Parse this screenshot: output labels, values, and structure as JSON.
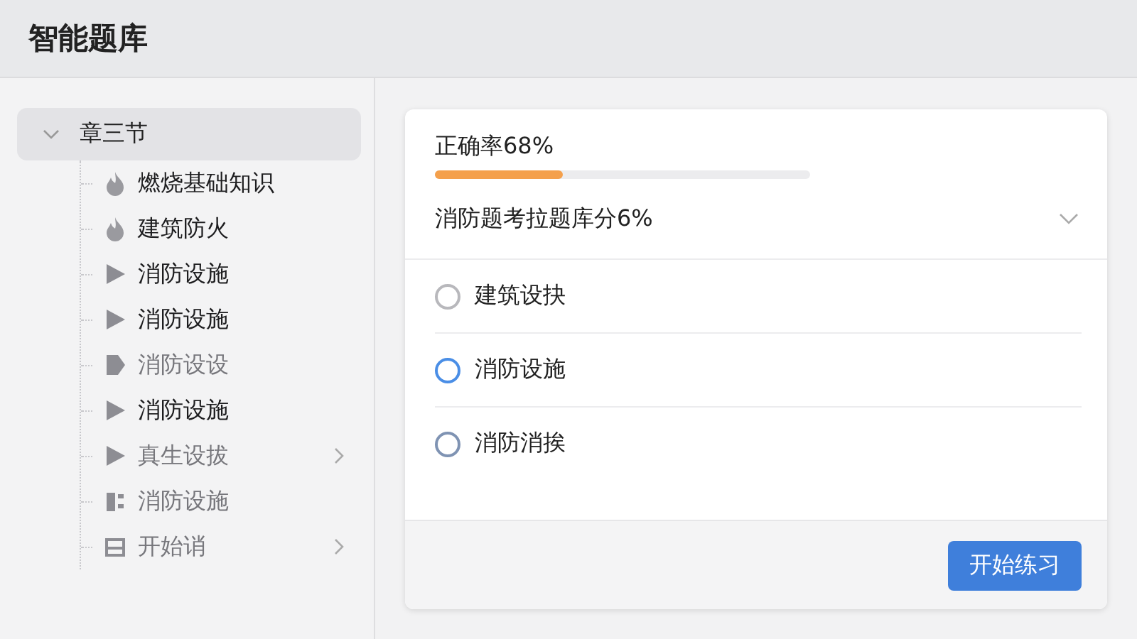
{
  "window": {
    "title": "智能题库"
  },
  "sidebar": {
    "root": {
      "label": "章三节",
      "expanded": true,
      "selected": true,
      "children": [
        {
          "label": "燃烧基础知识",
          "kind": "flame",
          "disabled": false,
          "expandable": false
        },
        {
          "label": "建筑防火",
          "kind": "flame",
          "disabled": false,
          "expandable": false
        },
        {
          "label": "消防设施",
          "kind": "play",
          "disabled": false,
          "expandable": false
        },
        {
          "label": "消防设施",
          "kind": "play",
          "disabled": false,
          "expandable": false
        },
        {
          "label": "消防设设",
          "kind": "tag",
          "disabled": true,
          "expandable": false
        },
        {
          "label": "消防设施",
          "kind": "play",
          "disabled": false,
          "expandable": false
        },
        {
          "label": "真生设拔",
          "kind": "play",
          "disabled": true,
          "expandable": true
        },
        {
          "label": "消防设施",
          "kind": "film",
          "disabled": true,
          "expandable": false
        },
        {
          "label": "开始诮",
          "kind": "tray",
          "disabled": true,
          "expandable": true
        }
      ]
    }
  },
  "card": {
    "accuracy": {
      "label": "正确率68%",
      "level": 0.34
    },
    "dropdown": {
      "value": "消防题考拉题库分6%",
      "expanded": false
    },
    "options": [
      {
        "label": "建筑设抉",
        "selected": false,
        "color": "#b8b8bc"
      },
      {
        "label": "消防设施",
        "selected": false,
        "color": "#4a8ee6"
      },
      {
        "label": "消防消挨",
        "selected": false,
        "color": "#7f93b3"
      }
    ],
    "button": "开始练习"
  }
}
